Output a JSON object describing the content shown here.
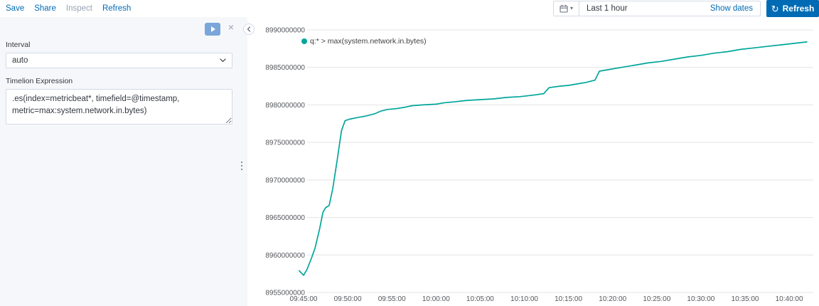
{
  "top_bar": {
    "links": [
      {
        "label": "Save"
      },
      {
        "label": "Share"
      },
      {
        "label": "Inspect"
      },
      {
        "label": "Refresh"
      }
    ],
    "time_picker": {
      "duration_label": "Last 1 hour",
      "show_dates_label": "Show dates",
      "refresh_label": "Refresh",
      "refresh_icon_glyph": "↻",
      "caret_glyph": "▾"
    }
  },
  "editor_panel": {
    "interval_label": "Interval",
    "interval_value": "auto",
    "expression_label": "Timelion Expression",
    "expression_value": ".es(index=metricbeat*, timefield=@timestamp, metric=max:system.network.in.bytes)",
    "close_glyph": "×"
  },
  "chart_data": {
    "type": "line",
    "legend": "q:* > max(system.network.in.bytes)",
    "series_color": "#00a69b",
    "grid": "horizontal",
    "legend_position": "top-left",
    "ylim": [
      8955000000,
      8990000000
    ],
    "y_ticks": [
      8990000000,
      8985000000,
      8980000000,
      8975000000,
      8970000000,
      8965000000,
      8960000000,
      8955000000
    ],
    "x_tick_minutes": [
      0,
      5,
      10,
      15,
      20,
      25,
      30,
      35,
      40,
      45,
      50,
      55
    ],
    "x_tick_labels": [
      "09:45:00",
      "09:50:00",
      "09:55:00",
      "10:00:00",
      "10:05:00",
      "10:10:00",
      "10:15:00",
      "10:20:00",
      "10:25:00",
      "10:30:00",
      "10:35:00",
      "10:40:00"
    ],
    "points": [
      [
        -0.5,
        8957900000
      ],
      [
        0.0,
        8957300000
      ],
      [
        0.4,
        8958100000
      ],
      [
        0.9,
        8959600000
      ],
      [
        1.3,
        8960900000
      ],
      [
        1.8,
        8963400000
      ],
      [
        2.2,
        8965700000
      ],
      [
        2.5,
        8966300000
      ],
      [
        2.9,
        8966600000
      ],
      [
        3.3,
        8968800000
      ],
      [
        3.8,
        8972600000
      ],
      [
        4.3,
        8976600000
      ],
      [
        4.7,
        8977900000
      ],
      [
        5.2,
        8978100000
      ],
      [
        6.0,
        8978300000
      ],
      [
        7.0,
        8978500000
      ],
      [
        8.0,
        8978800000
      ],
      [
        8.8,
        8979200000
      ],
      [
        9.5,
        8979400000
      ],
      [
        10.5,
        8979500000
      ],
      [
        11.5,
        8979700000
      ],
      [
        12.3,
        8979900000
      ],
      [
        13.5,
        8980000000
      ],
      [
        15.0,
        8980100000
      ],
      [
        16.0,
        8980300000
      ],
      [
        17.0,
        8980400000
      ],
      [
        18.5,
        8980600000
      ],
      [
        20.0,
        8980700000
      ],
      [
        21.5,
        8980800000
      ],
      [
        23.0,
        8981000000
      ],
      [
        24.5,
        8981100000
      ],
      [
        26.0,
        8981300000
      ],
      [
        27.2,
        8981500000
      ],
      [
        27.8,
        8982300000
      ],
      [
        29.0,
        8982500000
      ],
      [
        30.0,
        8982600000
      ],
      [
        31.0,
        8982800000
      ],
      [
        32.0,
        8983000000
      ],
      [
        33.0,
        8983300000
      ],
      [
        33.5,
        8984500000
      ],
      [
        34.5,
        8984700000
      ],
      [
        36.0,
        8985000000
      ],
      [
        37.5,
        8985300000
      ],
      [
        39.0,
        8985600000
      ],
      [
        40.5,
        8985800000
      ],
      [
        42.0,
        8986100000
      ],
      [
        43.5,
        8986400000
      ],
      [
        45.0,
        8986600000
      ],
      [
        46.5,
        8986900000
      ],
      [
        48.0,
        8987100000
      ],
      [
        49.5,
        8987400000
      ],
      [
        51.0,
        8987600000
      ],
      [
        52.5,
        8987800000
      ],
      [
        54.0,
        8988000000
      ],
      [
        55.5,
        8988200000
      ],
      [
        57.0,
        8988400000
      ]
    ]
  }
}
